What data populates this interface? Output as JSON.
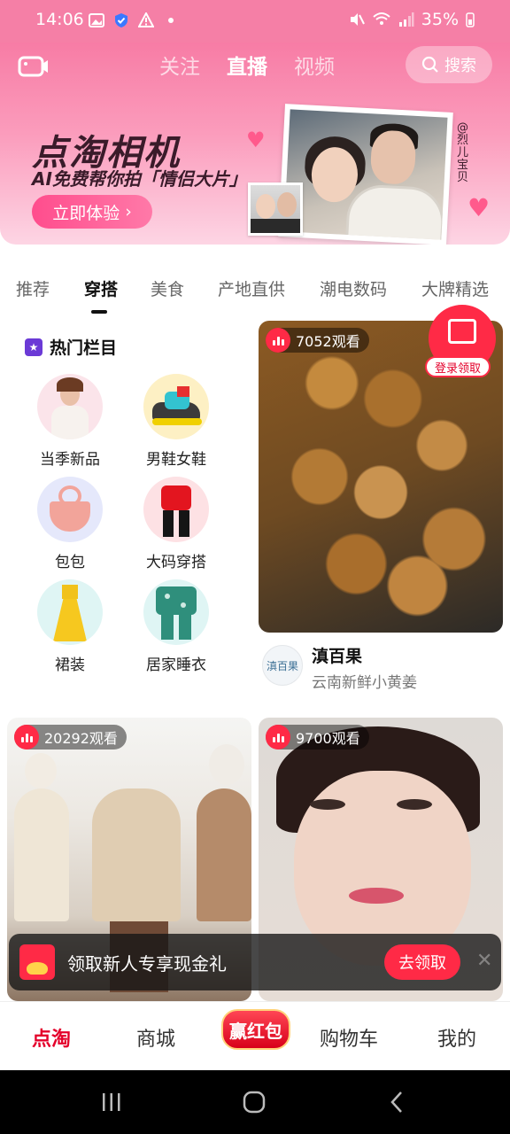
{
  "status_bar": {
    "time": "14:06",
    "battery": "35%"
  },
  "header": {
    "tabs": [
      {
        "label": "关注",
        "active": false
      },
      {
        "label": "直播",
        "active": true
      },
      {
        "label": "视频",
        "active": false
      }
    ],
    "search_label": "搜索"
  },
  "banner": {
    "title": "点淘相机",
    "subtitle": "AI免费帮你拍「情侣大片」",
    "cta_label": "立即体验",
    "credit": "@烈儿宝贝"
  },
  "category_tabs": [
    {
      "label": "推荐",
      "active": false
    },
    {
      "label": "穿搭",
      "active": true
    },
    {
      "label": "美食",
      "active": false
    },
    {
      "label": "产地直供",
      "active": false
    },
    {
      "label": "潮电数码",
      "active": false
    },
    {
      "label": "大牌精选",
      "active": false
    }
  ],
  "hot_column": {
    "title": "热门栏目",
    "items": [
      {
        "label": "当季新品",
        "icon": "woman-fashion-icon"
      },
      {
        "label": "男鞋女鞋",
        "icon": "sneaker-icon"
      },
      {
        "label": "包包",
        "icon": "handbag-icon"
      },
      {
        "label": "大码穿搭",
        "icon": "plus-size-outfit-icon"
      },
      {
        "label": "裙装",
        "icon": "dress-icon"
      },
      {
        "label": "居家睡衣",
        "icon": "pajamas-icon"
      }
    ]
  },
  "live_cards": [
    {
      "views": "7052观看",
      "shop_name": "滇百果",
      "shop_desc": "云南新鲜小黄姜",
      "avatar_text": "滇百果"
    },
    {
      "views": "20292观看"
    },
    {
      "views": "9700观看"
    }
  ],
  "coupon": {
    "label": "登录领取"
  },
  "promo": {
    "text": "领取新人专享现金礼",
    "button": "去领取"
  },
  "bottom_nav": {
    "items": [
      {
        "label": "点淘",
        "active": true
      },
      {
        "label": "商城",
        "active": false
      },
      {
        "label": "购物车",
        "active": false
      },
      {
        "label": "我的",
        "active": false
      }
    ],
    "center_label": "赢红包"
  },
  "colors": {
    "accent": "#ff2a46",
    "header_pink": "#f77ca5",
    "active_nav": "#e4002b"
  }
}
